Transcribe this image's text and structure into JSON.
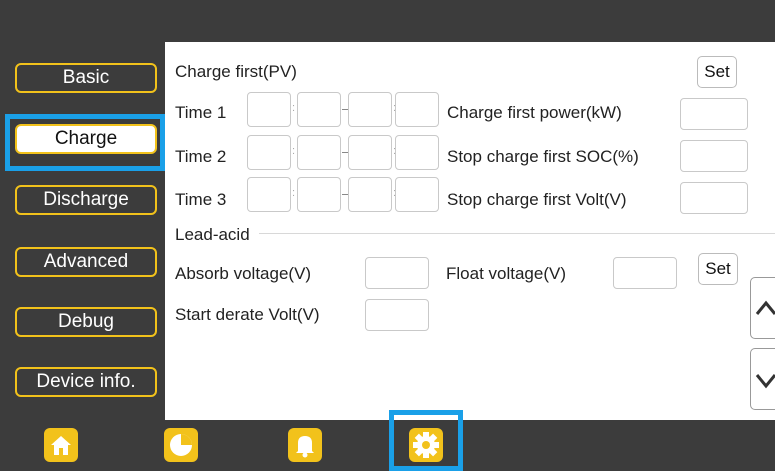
{
  "sidebar": {
    "items": [
      {
        "label": "Basic"
      },
      {
        "label": "Charge"
      },
      {
        "label": "Discharge"
      },
      {
        "label": "Advanced"
      },
      {
        "label": "Debug"
      },
      {
        "label": "Device info."
      }
    ],
    "active": "Charge"
  },
  "charge_first": {
    "heading": "Charge first(PV)",
    "set_label": "Set",
    "time_rows": [
      {
        "label": "Time 1",
        "field_label": "Charge first power(kW)",
        "field_value": ""
      },
      {
        "label": "Time 2",
        "field_label": "Stop charge first SOC(%)",
        "field_value": ""
      },
      {
        "label": "Time 3",
        "field_label": "Stop charge first Volt(V)",
        "field_value": ""
      }
    ],
    "time_values": [
      "",
      "",
      "",
      ""
    ],
    "time_colon": ":"
  },
  "lead_acid": {
    "heading": "Lead-acid",
    "absorb_label": "Absorb voltage(V)",
    "absorb_value": "",
    "float_label": "Float voltage(V)",
    "float_value": "",
    "set_label": "Set",
    "derate_label": "Start derate Volt(V)",
    "derate_value": ""
  },
  "bottom_nav": {
    "items": [
      "home-icon",
      "pie-chart-icon",
      "bell-icon",
      "gear-icon"
    ],
    "active": "gear-icon"
  },
  "colors": {
    "accent": "#f2c21b",
    "selection": "#1aa0e8",
    "background": "#3c3c3c"
  }
}
